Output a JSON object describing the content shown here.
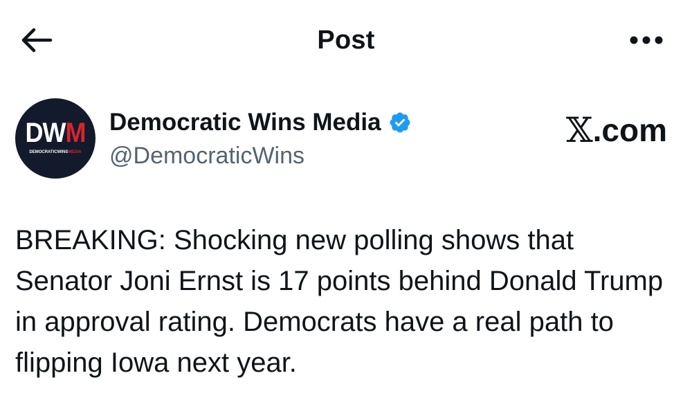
{
  "header": {
    "title": "Post",
    "back_icon": "arrow-left-icon",
    "more_icon": "more-horizontal-icon"
  },
  "author": {
    "avatar_logo_dw": "DW",
    "avatar_logo_m": "M",
    "avatar_sub_left": "DEMOCRATICWINS",
    "avatar_sub_right": "MEDIA",
    "display_name": "Democratic Wins Media",
    "verified_icon": "verified-badge-icon",
    "handle": "@DemocraticWins"
  },
  "site_mark": {
    "glyph": "𝕏",
    "suffix": ".com"
  },
  "post": {
    "text": "BREAKING: Shocking new polling shows that Senator Joni Ernst is 17 points behind Donald Trump in approval rating. Democrats have a real path to flipping Iowa next year."
  },
  "colors": {
    "text": "#0f1419",
    "secondary": "#536471",
    "verified": "#1d9bf0",
    "avatar_bg": "#131a2c",
    "avatar_red": "#d5262e"
  }
}
